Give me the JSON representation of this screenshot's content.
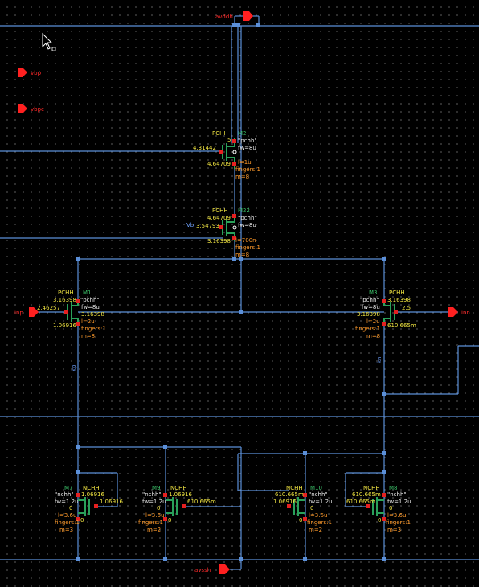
{
  "pins": {
    "avddh": "avddh",
    "vbp": "vbp",
    "vbpc": "vbpc",
    "inp": "inp",
    "inn": "inn",
    "avssh": "avssh"
  },
  "nets": {
    "kp": "kp",
    "kn": "kn",
    "vb_partial": "Vb"
  },
  "devices": {
    "M2": {
      "type": "PCHH",
      "name": "M2",
      "model": "\"pchh\"",
      "fw": "fw=8u",
      "l": "l=1u",
      "fingers": "fingers:1",
      "m": "m=8",
      "v_gate": "4.31442",
      "v_drain": "4.64709",
      "v_source": "5"
    },
    "M22": {
      "type": "PCHH",
      "name": "M22",
      "model": "\"pchh\"",
      "fw": "fw=8u",
      "l": "l=700n",
      "fingers": "fingers:1",
      "m": "m=8",
      "v_source": "4.64709",
      "v_gate": "3.54793",
      "v_drain": "3.16398"
    },
    "M1": {
      "type": "PCHH",
      "name": "M1",
      "model": "\"pchh\"",
      "fw": "fw=8u",
      "l": "l=2u",
      "fingers": "fingers:1",
      "m": "m=8",
      "v_source_l": "3.16398",
      "v_source_r": "3.16398",
      "v_gate": "2.46257",
      "v_drain": "1.06916"
    },
    "M3": {
      "type": "PCHH",
      "name": "M3",
      "model": "\"pchh\"",
      "fw": "fw=8u",
      "l": "l=2u",
      "fingers": "fingers:1",
      "m": "m=8",
      "v_source_l": "3.16398",
      "v_source_r": "3.16398",
      "v_gate": "2.5",
      "v_drain_l": "610.665m",
      "v_drain_r": "610.665m"
    },
    "M7": {
      "type": "NCHH",
      "name": "M7",
      "model": "\"nchh\"",
      "fw": "fw=1.2u",
      "l": "l=3.6u",
      "fingers": "fingers:1",
      "m": "m=3",
      "v_drain": "1.06916",
      "v_gate_l": "1.06916",
      "v_gate_r": "1.06916",
      "v_source": "0",
      "v_bulk": "0"
    },
    "M9": {
      "type": "NCHH",
      "name": "M9",
      "model": "\"nchh\"",
      "fw": "fw=1.2u",
      "l": "l=3.6u",
      "fingers": "fingers:1",
      "m": "m=2",
      "v_drain": "1.06916",
      "v_gate_l": "1.06916",
      "v_gate_r": "610.665m",
      "v_source": "0",
      "v_bulk": "0"
    },
    "M10": {
      "type": "NCHH",
      "name": "M10",
      "model": "\"nchh\"",
      "fw": "fw=1.2u",
      "l": "l=3.6u",
      "fingers": "fingers:1",
      "m": "m=2",
      "v_drain": "610.665m",
      "v_gate_l": "1.06916",
      "v_gate_r": "610.665m",
      "v_source": "0",
      "v_bulk": "0"
    },
    "M8": {
      "type": "NCHH",
      "name": "M8",
      "model": "\"nchh\"",
      "fw": "fw=1.2u",
      "l": "l=3.6u",
      "fingers": "fingers:1",
      "m": "m=3",
      "v_drain": "610.665m",
      "v_gate_l": "610.665m",
      "v_gate_r": "610.665m",
      "v_source": "0",
      "v_bulk": "0"
    }
  },
  "colors": {
    "wire": "#5b8fd8",
    "device": "#2aa15a",
    "pin": "#ff2020",
    "voltage_label": "#f2e642",
    "param_label": "#ff9a2a",
    "instance_name": "#3cc36a",
    "background": "#000000"
  },
  "cursor_icon": "arrow-cursor-icon"
}
